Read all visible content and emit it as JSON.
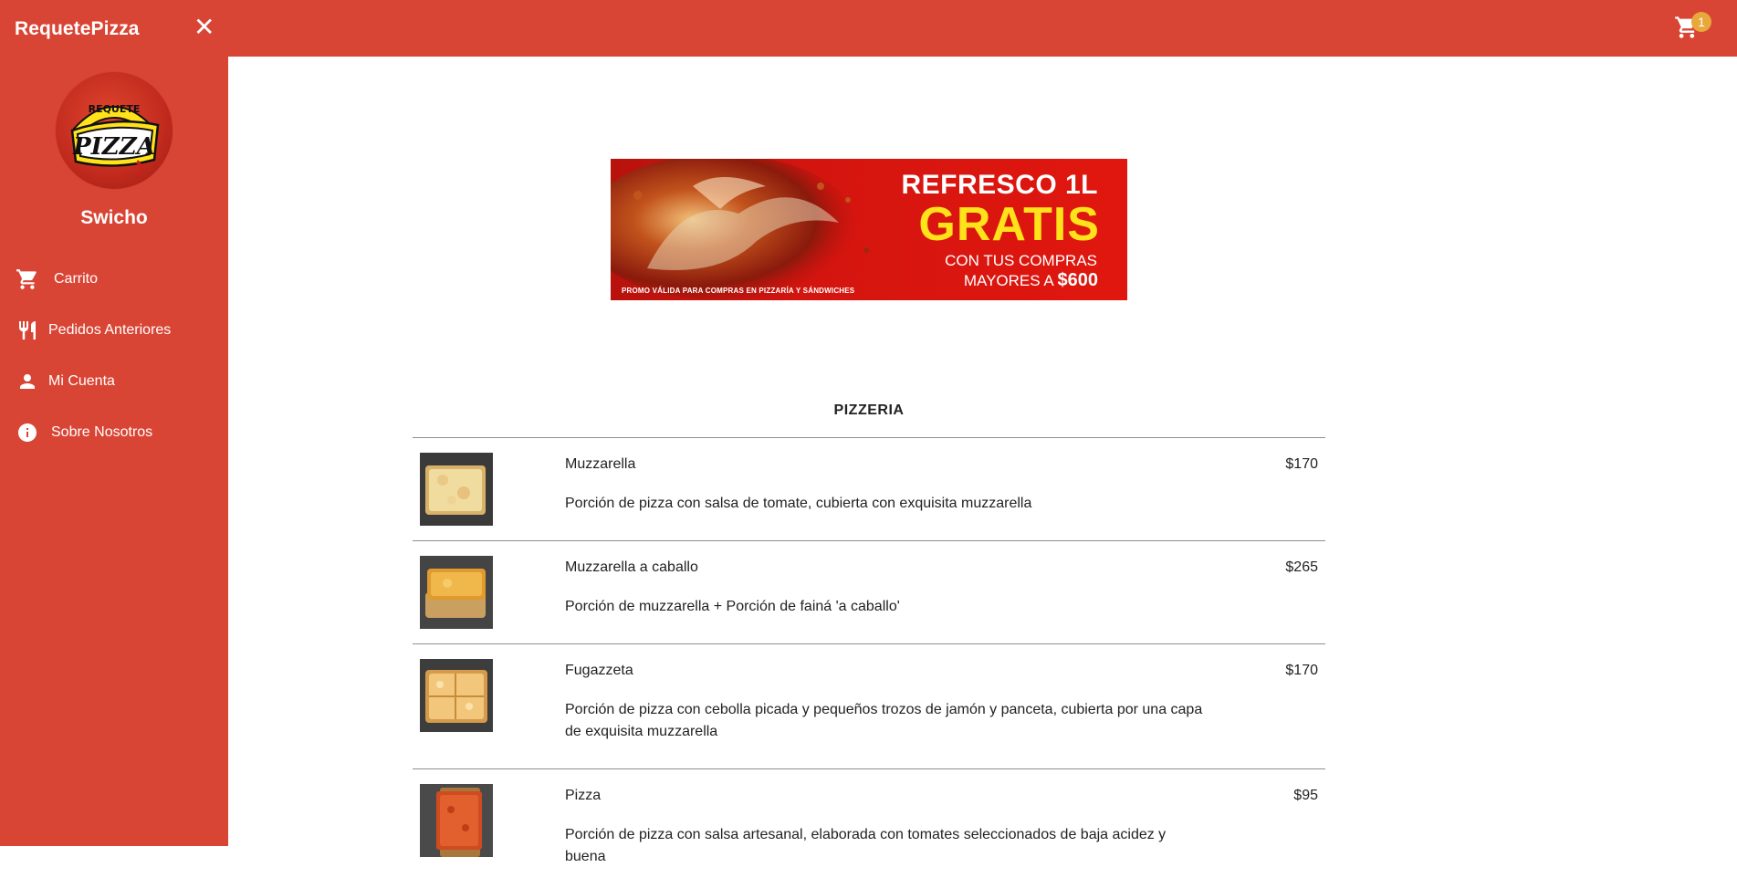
{
  "app": {
    "brand": "RequetePizza",
    "close_glyph": "✕",
    "logo_text_top": "REQUETE",
    "logo_text_main": "PIZZA"
  },
  "user": {
    "name": "Swicho"
  },
  "cart": {
    "count": "1"
  },
  "nav": {
    "items": [
      {
        "label": "Carrito",
        "icon": "cart-icon"
      },
      {
        "label": "Pedidos Anteriores",
        "icon": "fork-knife-icon"
      },
      {
        "label": "Mi Cuenta",
        "icon": "person-icon"
      },
      {
        "label": "Sobre Nosotros",
        "icon": "info-icon"
      }
    ]
  },
  "banner": {
    "line1": "REFRESCO 1L",
    "line2": "GRATIS",
    "line3": "CON TUS COMPRAS",
    "line4_prefix": "MAYORES A ",
    "line4_amount": "$600",
    "fine_print": "PROMO VÁLIDA PARA COMPRAS EN PIZZARÍA Y SÁNDWICHES"
  },
  "menu": {
    "section_title": "PIZZERIA",
    "items": [
      {
        "name": "Muzzarella",
        "price": "$170",
        "description": "Porción de pizza con salsa de tomate, cubierta con exquisita muzzarella"
      },
      {
        "name": "Muzzarella a caballo",
        "price": "$265",
        "description": "Porción de muzzarella + Porción de fainá 'a caballo'"
      },
      {
        "name": "Fugazzeta",
        "price": "$170",
        "description": "Porción de pizza con cebolla picada y pequeños trozos de jamón y panceta, cubierta por una capa de exquisita muzzarella"
      },
      {
        "name": "Pizza",
        "price": "$95",
        "description": "Porción de pizza con salsa artesanal, elaborada con tomates seleccionados de baja acidez y buena"
      }
    ]
  },
  "colors": {
    "primary": "#d94535",
    "badge": "#e8a83c",
    "banner_red": "#d4150f",
    "banner_yellow": "#ffe21a"
  }
}
